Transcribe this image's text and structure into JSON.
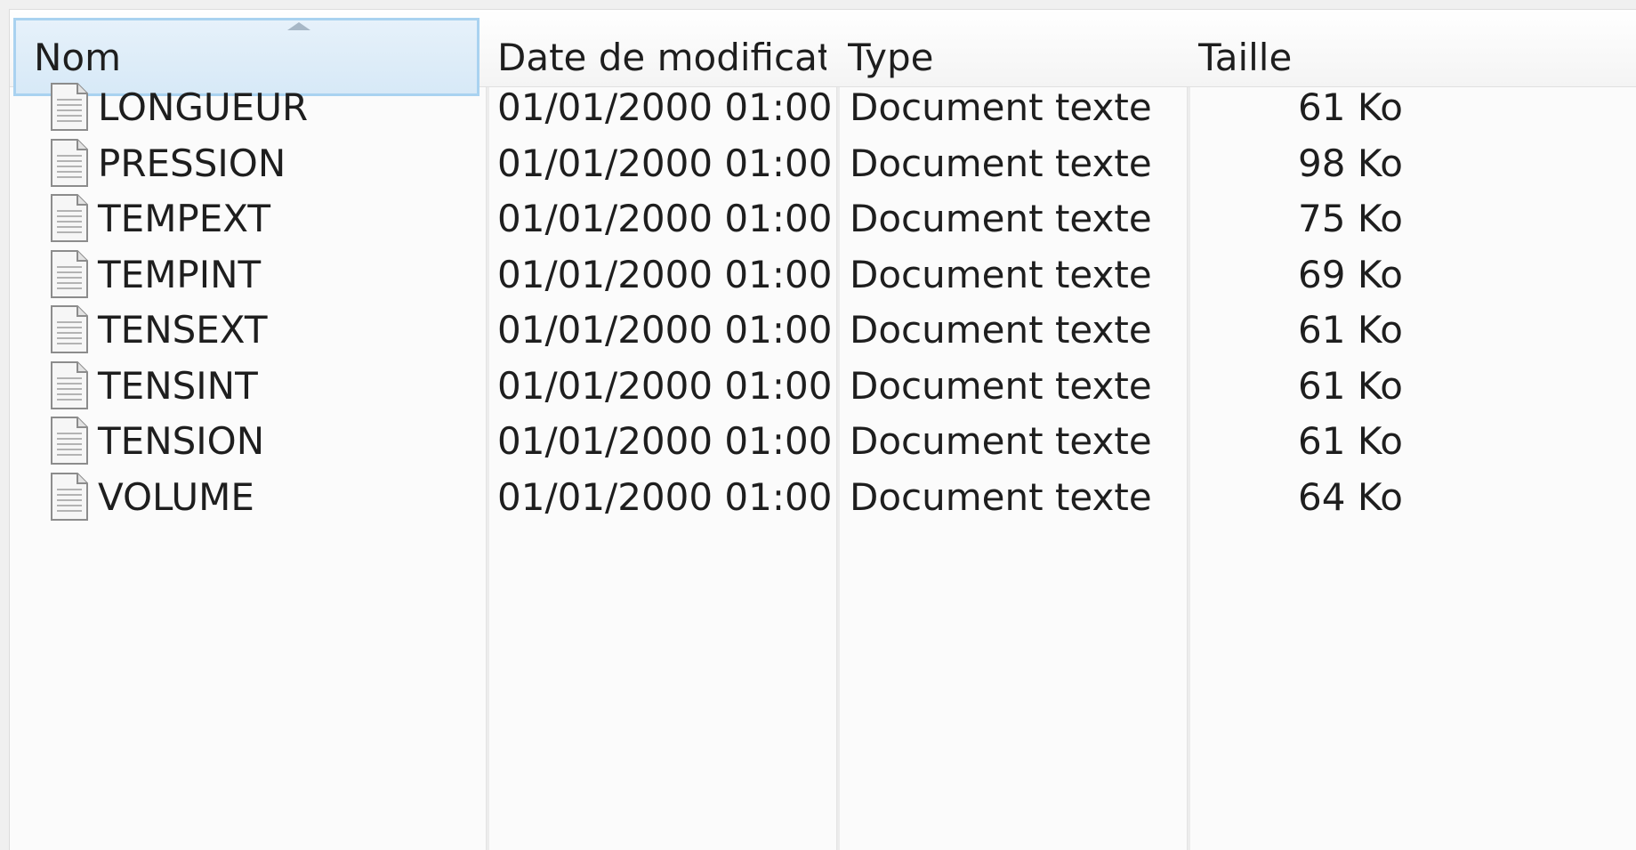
{
  "columns": {
    "name": "Nom",
    "date": "Date de modificati...",
    "type": "Type",
    "size": "Taille"
  },
  "files": [
    {
      "name": "LONGUEUR",
      "date": "01/01/2000 01:00",
      "type": "Document texte",
      "size": "61 Ko"
    },
    {
      "name": "PRESSION",
      "date": "01/01/2000 01:00",
      "type": "Document texte",
      "size": "98 Ko"
    },
    {
      "name": "TEMPEXT",
      "date": "01/01/2000 01:00",
      "type": "Document texte",
      "size": "75 Ko"
    },
    {
      "name": "TEMPINT",
      "date": "01/01/2000 01:00",
      "type": "Document texte",
      "size": "69 Ko"
    },
    {
      "name": "TENSEXT",
      "date": "01/01/2000 01:00",
      "type": "Document texte",
      "size": "61 Ko"
    },
    {
      "name": "TENSINT",
      "date": "01/01/2000 01:00",
      "type": "Document texte",
      "size": "61 Ko"
    },
    {
      "name": "TENSION",
      "date": "01/01/2000 01:00",
      "type": "Document texte",
      "size": "61 Ko"
    },
    {
      "name": "VOLUME",
      "date": "01/01/2000 01:00",
      "type": "Document texte",
      "size": "64 Ko"
    }
  ],
  "icons": {
    "file": "text-document-icon",
    "sort": "sort-ascending-icon"
  },
  "colors": {
    "sorted_header_border": "#a9d2f0",
    "sorted_header_bg": "#d7e9f7"
  }
}
